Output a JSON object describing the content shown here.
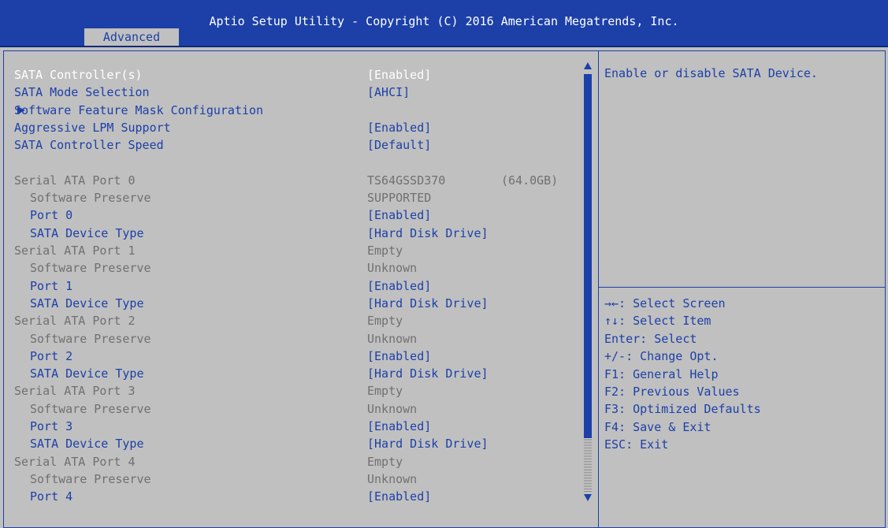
{
  "header": {
    "title": "Aptio Setup Utility - Copyright (C) 2016 American Megatrends, Inc.",
    "tab": "Advanced"
  },
  "colors": {
    "accent": "#1c40a8",
    "background": "#c0c0c0",
    "selected_text": "#ffffff",
    "info_text": "#707070"
  },
  "settings": [
    {
      "label": "SATA Controller(s)",
      "value": "[Enabled]"
    },
    {
      "label": "SATA Mode Selection",
      "value": "[AHCI]"
    },
    {
      "label": "Software Feature Mask Configuration",
      "value": ""
    },
    {
      "label": "Aggressive LPM Support",
      "value": "[Enabled]"
    },
    {
      "label": "SATA Controller Speed",
      "value": "[Default]"
    }
  ],
  "submenu_icon": "triangle-right-icon",
  "ports": [
    {
      "port_label": "Serial ATA Port 0",
      "device": "TS64GSSD370",
      "size": "(64.0GB)",
      "preserve_label": "Software Preserve",
      "preserve_value": "SUPPORTED",
      "enable_label": "Port 0",
      "enable_value": "[Enabled]",
      "type_label": "SATA Device Type",
      "type_value": "[Hard Disk Drive]"
    },
    {
      "port_label": "Serial ATA Port 1",
      "device": "Empty",
      "preserve_label": "Software Preserve",
      "preserve_value": "Unknown",
      "enable_label": "Port 1",
      "enable_value": "[Enabled]",
      "type_label": "SATA Device Type",
      "type_value": "[Hard Disk Drive]"
    },
    {
      "port_label": "Serial ATA Port 2",
      "device": "Empty",
      "preserve_label": "Software Preserve",
      "preserve_value": "Unknown",
      "enable_label": "Port 2",
      "enable_value": "[Enabled]",
      "type_label": "SATA Device Type",
      "type_value": "[Hard Disk Drive]"
    },
    {
      "port_label": "Serial ATA Port 3",
      "device": "Empty",
      "preserve_label": "Software Preserve",
      "preserve_value": "Unknown",
      "enable_label": "Port 3",
      "enable_value": "[Enabled]",
      "type_label": "SATA Device Type",
      "type_value": "[Hard Disk Drive]"
    },
    {
      "port_label": "Serial ATA Port 4",
      "device": "Empty",
      "preserve_label": "Software Preserve",
      "preserve_value": "Unknown",
      "enable_label": "Port 4",
      "enable_value": "[Enabled]"
    }
  ],
  "help": {
    "description": "Enable or disable SATA Device.",
    "keys": [
      "→←: Select Screen",
      "↑↓: Select Item",
      "Enter: Select",
      "+/-: Change Opt.",
      "F1: General Help",
      "F2: Previous Values",
      "F3: Optimized Defaults",
      "F4: Save & Exit",
      "ESC: Exit"
    ]
  },
  "scrollbar": {
    "up_icon": "scroll-up-arrow-icon",
    "down_icon": "scroll-down-arrow-icon"
  }
}
